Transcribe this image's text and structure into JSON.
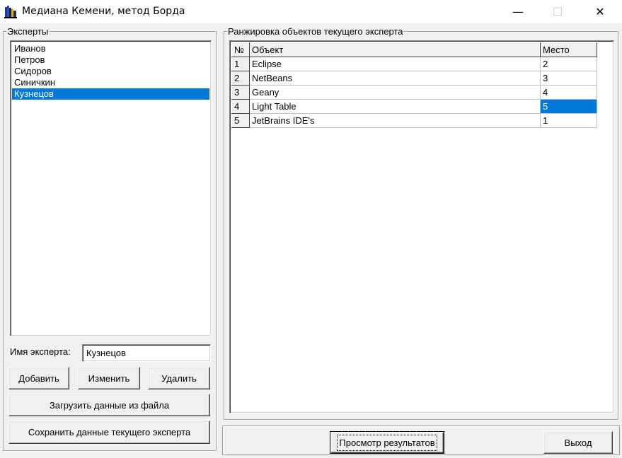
{
  "window": {
    "title": "Медиана Кемени, метод Борда",
    "minimize_glyph": "—",
    "maximize_glyph": "☐",
    "close_glyph": "✕",
    "icon": "app-books-icon"
  },
  "experts": {
    "group_title": "Эксперты",
    "items": [
      {
        "label": "Иванов"
      },
      {
        "label": "Петров"
      },
      {
        "label": "Сидоров"
      },
      {
        "label": "Синичкин"
      },
      {
        "label": "Кузнецов"
      }
    ],
    "selected_index": 4,
    "name_label": "Имя эксперта:",
    "name_value": "Кузнецов",
    "add_label": "Добавить",
    "edit_label": "Изменить",
    "delete_label": "Удалить",
    "load_label": "Загрузить данные из файла",
    "save_label": "Сохранить данные текущего эксперта"
  },
  "ranking": {
    "group_title": "Ранжировка объектов текущего эксперта",
    "columns": [
      "№",
      "Объект",
      "Место"
    ],
    "rows": [
      {
        "num": "1",
        "object": "Eclipse",
        "place": "2"
      },
      {
        "num": "2",
        "object": "NetBeans",
        "place": "3"
      },
      {
        "num": "3",
        "object": "Geany",
        "place": "4"
      },
      {
        "num": "4",
        "object": "Light Table",
        "place": "5"
      },
      {
        "num": "5",
        "object": "JetBrains IDE's",
        "place": "1"
      }
    ],
    "selected_row": 3,
    "selected_col": "place"
  },
  "footer": {
    "view_label": "Просмотр результатов",
    "exit_label": "Выход"
  },
  "colors": {
    "selection": "#0078d7",
    "face": "#f0f0f0"
  }
}
